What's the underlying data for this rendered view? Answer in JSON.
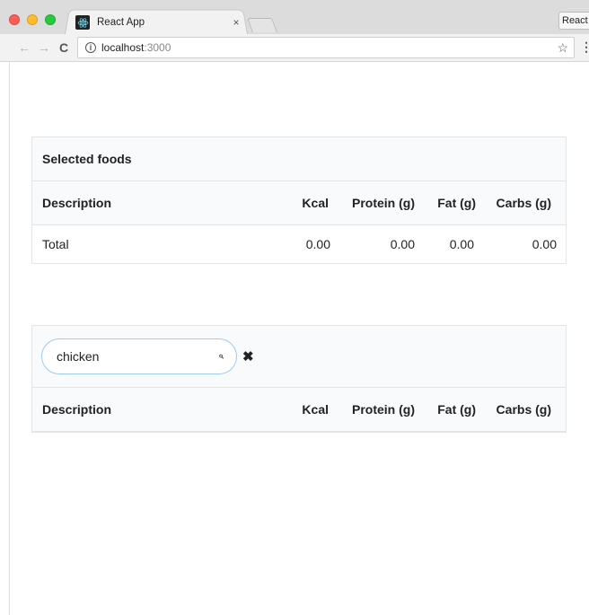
{
  "browser": {
    "tab_title": "React App",
    "tab_close": "×",
    "right_tab_label": "React",
    "url_host": "localhost",
    "url_port": ":3000",
    "info_icon": "i",
    "icons": [
      "back-icon",
      "forward-icon",
      "reload-icon",
      "info-icon",
      "star-icon",
      "menu-icon"
    ]
  },
  "selected_foods": {
    "title": "Selected foods",
    "columns": [
      "Description",
      "Kcal",
      "Protein (g)",
      "Fat (g)",
      "Carbs (g)"
    ],
    "total_row": {
      "label": "Total",
      "kcal": "0.00",
      "protein": "0.00",
      "fat": "0.00",
      "carbs": "0.00"
    }
  },
  "food_search": {
    "query": "chicken",
    "columns": [
      "Description",
      "Kcal",
      "Protein (g)",
      "Fat (g)",
      "Carbs (g)"
    ]
  },
  "colors": {
    "border": "#e2e4e6",
    "header_bg": "#f9fafb",
    "search_border": "#9ecaed"
  }
}
